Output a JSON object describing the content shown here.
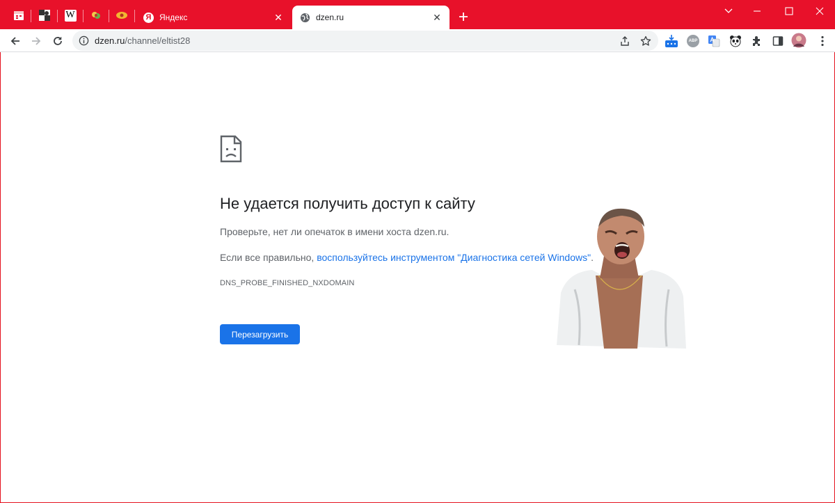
{
  "browser": {
    "accent_color": "#e8112a",
    "pinned_tabs": [
      {
        "icon": "calendar-favicon-icon"
      },
      {
        "icon": "chess-favicon-icon"
      },
      {
        "icon": "wikipedia-favicon-icon",
        "glyph": "W"
      },
      {
        "icon": "flower-favicon-icon"
      },
      {
        "icon": "eye-favicon-icon"
      }
    ],
    "tabs": [
      {
        "title": "Яндекс",
        "favicon_glyph": "Я",
        "active": false
      },
      {
        "title": "dzen.ru",
        "favicon": "globe-icon",
        "active": true
      }
    ],
    "address": {
      "host": "dzen.ru",
      "path": "/channel/eltist28"
    },
    "extensions": [
      {
        "name": "download-badge-extension-icon"
      },
      {
        "name": "adblock-extension-icon",
        "text": "ABP"
      },
      {
        "name": "translate-extension-icon"
      },
      {
        "name": "panda-extension-icon"
      },
      {
        "name": "extensions-puzzle-icon"
      },
      {
        "name": "side-panel-icon"
      },
      {
        "name": "profile-avatar"
      }
    ]
  },
  "error_page": {
    "title": "Не удается получить доступ к сайту",
    "line1": "Проверьте, нет ли опечаток в имени хоста dzen.ru.",
    "line2_prefix": "Если все правильно, ",
    "line2_link": "воспользуйтесь инструментом \"Диагностика сетей Windows\"",
    "line2_suffix": ".",
    "error_code": "DNS_PROBE_FINISHED_NXDOMAIN",
    "reload_label": "Перезагрузить",
    "link_color": "#1a73e8",
    "button_color": "#1a73e8"
  }
}
